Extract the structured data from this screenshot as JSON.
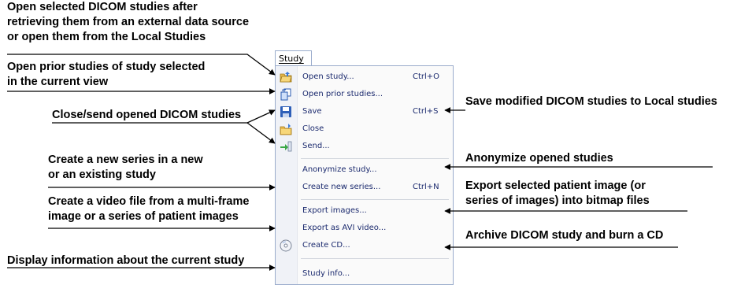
{
  "menu": {
    "title": "Study",
    "items": [
      {
        "label": "Open study...",
        "shortcut": "Ctrl+O",
        "icon": "open-folder-icon"
      },
      {
        "label": "Open prior studies...",
        "shortcut": "",
        "icon": "prior-studies-icon"
      },
      {
        "label": "Save",
        "shortcut": "Ctrl+S",
        "icon": "save-disk-icon"
      },
      {
        "label": "Close",
        "shortcut": "",
        "icon": "close-folder-icon"
      },
      {
        "label": "Send...",
        "shortcut": "",
        "icon": "send-icon"
      },
      {
        "label": "Anonymize study...",
        "shortcut": ""
      },
      {
        "label": "Create new series...",
        "shortcut": "Ctrl+N"
      },
      {
        "label": "Export images...",
        "shortcut": ""
      },
      {
        "label": "Export as AVI video...",
        "shortcut": ""
      },
      {
        "label": "Create CD...",
        "shortcut": "",
        "icon": "cd-icon"
      },
      {
        "label": "Study info...",
        "shortcut": ""
      }
    ]
  },
  "annotations": {
    "open_selected": [
      "Open selected DICOM studies after",
      "retrieving them from an external data source",
      "or open them from the Local Studies"
    ],
    "open_prior": [
      "Open prior studies of study selected",
      "in the current view"
    ],
    "close_send": "Close/send opened DICOM studies",
    "create_series": [
      "Create a new series in a new",
      "or an existing study"
    ],
    "create_video": [
      "Create a video file from a multi-frame",
      "image or a series of patient images"
    ],
    "display_info": "Display information about the current study",
    "save_modified": "Save modified DICOM studies to Local studies",
    "anonymize": "Anonymize opened studies",
    "export_images": [
      "Export selected patient image (or",
      "series of images) into bitmap files"
    ],
    "archive_cd": "Archive DICOM study and burn a CD"
  }
}
